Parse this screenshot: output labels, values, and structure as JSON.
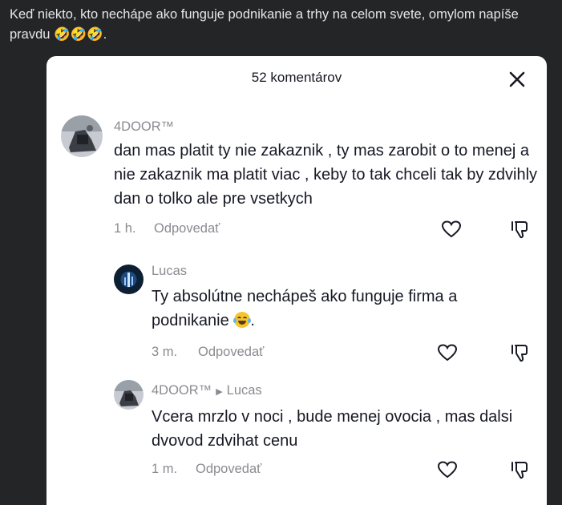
{
  "post": {
    "text": "Keď niekto, kto nechápe ako funguje podnikanie a trhy na celom svete, omylom napíše pravdu",
    "emoji_suffix": "🤣🤣🤣."
  },
  "sheet": {
    "title": "52 komentárov",
    "close_label": "close"
  },
  "comments": [
    {
      "username": "4DOOR™",
      "text": "dan mas platit ty nie zakaznik , ty mas zarobit o to menej a nie zakaznik ma platit viac , keby to tak chceli tak by zdvihly dan o tolko ale pre vsetkych",
      "time": "1 h.",
      "reply_label": "Odpovedať"
    },
    {
      "username": "Lucas",
      "text": "Ty absolútne nechápeš ako funguje firma a podnikanie",
      "text_suffix": ".",
      "time": "3 m.",
      "reply_label": "Odpovedať"
    },
    {
      "username": "4DOOR™",
      "reply_to": "Lucas",
      "text": "Vcera mrzlo v noci , bude menej ovocia , mas dalsi dvovod zdvihat cenu",
      "time": "1 m.",
      "reply_label": "Odpovedať"
    }
  ],
  "colors": {
    "page_bg": "#242526",
    "sheet_bg": "#ffffff",
    "text_primary": "#161823",
    "text_secondary": "#8a8b91"
  }
}
